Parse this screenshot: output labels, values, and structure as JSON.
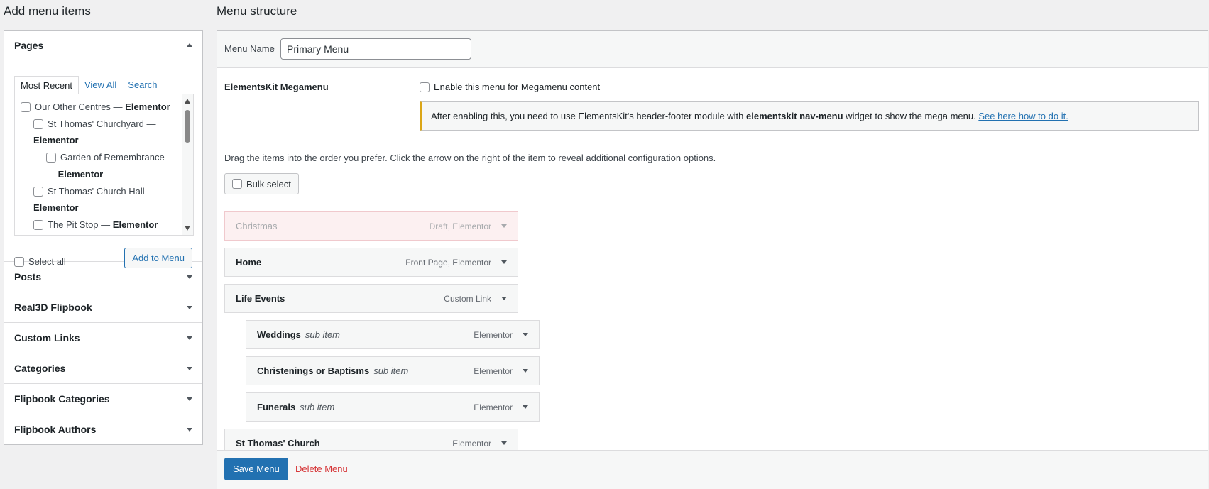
{
  "left": {
    "heading": "Add menu items",
    "pages_section": {
      "title": "Pages",
      "tabs": [
        "Most Recent",
        "View All",
        "Search"
      ],
      "items": [
        {
          "title": "Our Other Centres",
          "suffix": "Elementor",
          "depth": 0
        },
        {
          "title": "St Thomas' Churchyard",
          "suffix": "Elementor",
          "depth": 1
        },
        {
          "title": "Garden of Remembrance",
          "suffix": "Elementor",
          "depth": 2
        },
        {
          "title": "St Thomas' Church Hall",
          "suffix": "Elementor",
          "depth": 1
        },
        {
          "title": "The Pit Stop",
          "suffix": "Elementor",
          "depth": 1
        }
      ],
      "select_all": "Select all",
      "add_button": "Add to Menu"
    },
    "sections": [
      "Posts",
      "Real3D Flipbook",
      "Custom Links",
      "Categories",
      "Flipbook Categories",
      "Flipbook Authors"
    ]
  },
  "right": {
    "heading": "Menu structure",
    "menu_name_label": "Menu Name",
    "menu_name_value": "Primary Menu",
    "megamenu": {
      "label": "ElementsKit Megamenu",
      "checkbox_label": "Enable this menu for Megamenu content",
      "notice_prefix": "After enabling this, you need to use ElementsKit's header-footer module with ",
      "notice_bold": "elementskit nav-menu",
      "notice_suffix": " widget to show the mega menu. ",
      "notice_link": "See here how to do it."
    },
    "instructions": "Drag the items into the order you prefer. Click the arrow on the right of the item to reveal additional configuration options.",
    "bulk_select": "Bulk select",
    "menu_items": [
      {
        "title": "Christmas",
        "sub": "",
        "type": "Draft, Elementor",
        "draft": true,
        "depth": 0
      },
      {
        "title": "Home",
        "sub": "",
        "type": "Front Page, Elementor",
        "draft": false,
        "depth": 0
      },
      {
        "title": "Life Events",
        "sub": "",
        "type": "Custom Link",
        "draft": false,
        "depth": 0
      },
      {
        "title": "Weddings",
        "sub": "sub item",
        "type": "Elementor",
        "draft": false,
        "depth": 1
      },
      {
        "title": "Christenings or Baptisms",
        "sub": "sub item",
        "type": "Elementor",
        "draft": false,
        "depth": 1
      },
      {
        "title": "Funerals",
        "sub": "sub item",
        "type": "Elementor",
        "draft": false,
        "depth": 1
      },
      {
        "title": "St Thomas' Church",
        "sub": "",
        "type": "Elementor",
        "draft": false,
        "depth": 0
      }
    ],
    "save_button": "Save Menu",
    "delete_link": "Delete Menu"
  }
}
